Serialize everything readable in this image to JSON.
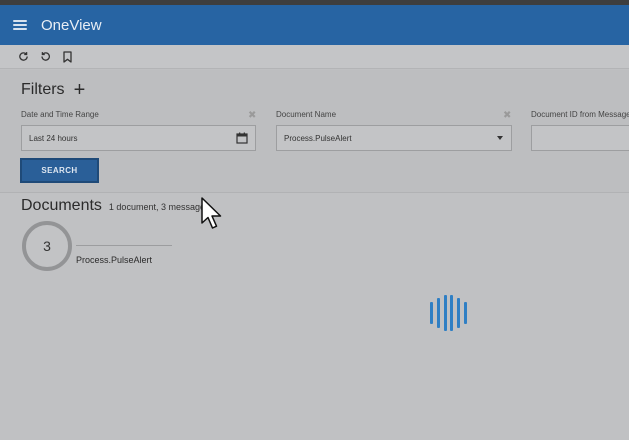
{
  "app": {
    "title": "OneView"
  },
  "toolbar": {
    "refresh_icon": "refresh-icon",
    "undo_icon": "undo-icon",
    "bookmark_icon": "bookmark-icon"
  },
  "filters": {
    "title": "Filters",
    "add_symbol": "+",
    "date_range": {
      "label": "Date and Time Range",
      "value": "Last 24 hours"
    },
    "document_name": {
      "label": "Document Name",
      "value": "Process.PulseAlert"
    },
    "document_id": {
      "label": "Document ID from Message"
    },
    "search_label": "SEARCH"
  },
  "documents": {
    "title": "Documents",
    "summary": "1 document, 3 messages",
    "items": [
      {
        "count": "3",
        "name": "Process.PulseAlert"
      }
    ]
  },
  "colors": {
    "app_bar": "#2764a3",
    "primary_button": "#2a5f98",
    "loader": "#2f7fc4"
  }
}
